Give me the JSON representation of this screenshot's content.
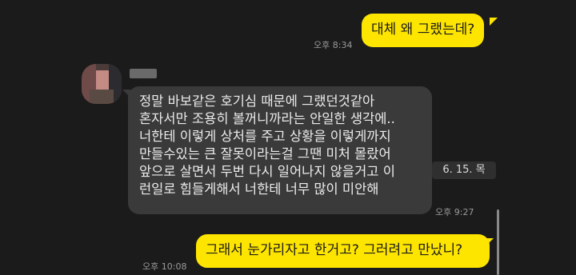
{
  "messages": [
    {
      "from": "me",
      "text": "대체 왜 그랬는데?",
      "time": "오후 8:34"
    },
    {
      "from": "other",
      "lines": [
        "정말 바보같은 호기심 때문에 그랬던것같아",
        "혼자서만 조용히 볼꺼니까라는 안일한 생각에..",
        "너한테 이렇게 상처를 주고 상황을 이렇게까지",
        "만들수있는 큰  잘못이라는걸 그땐 미처 몰랐어",
        "앞으로 살면서 두번 다시 일어나지 않을거고 이",
        "런일로 힘들게해서 너한테 너무 많이 미안해"
      ],
      "time": "오후 9:27"
    },
    {
      "from": "me",
      "text": "그래서 눈가리자고 한거고? 그러려고 만났니?",
      "time": "오후 10:08"
    }
  ],
  "date_chip": "6. 15. 목",
  "colors": {
    "background": "#1b1b1b",
    "outgoing_bubble": "#fee500",
    "incoming_bubble": "#3a3a3a"
  }
}
